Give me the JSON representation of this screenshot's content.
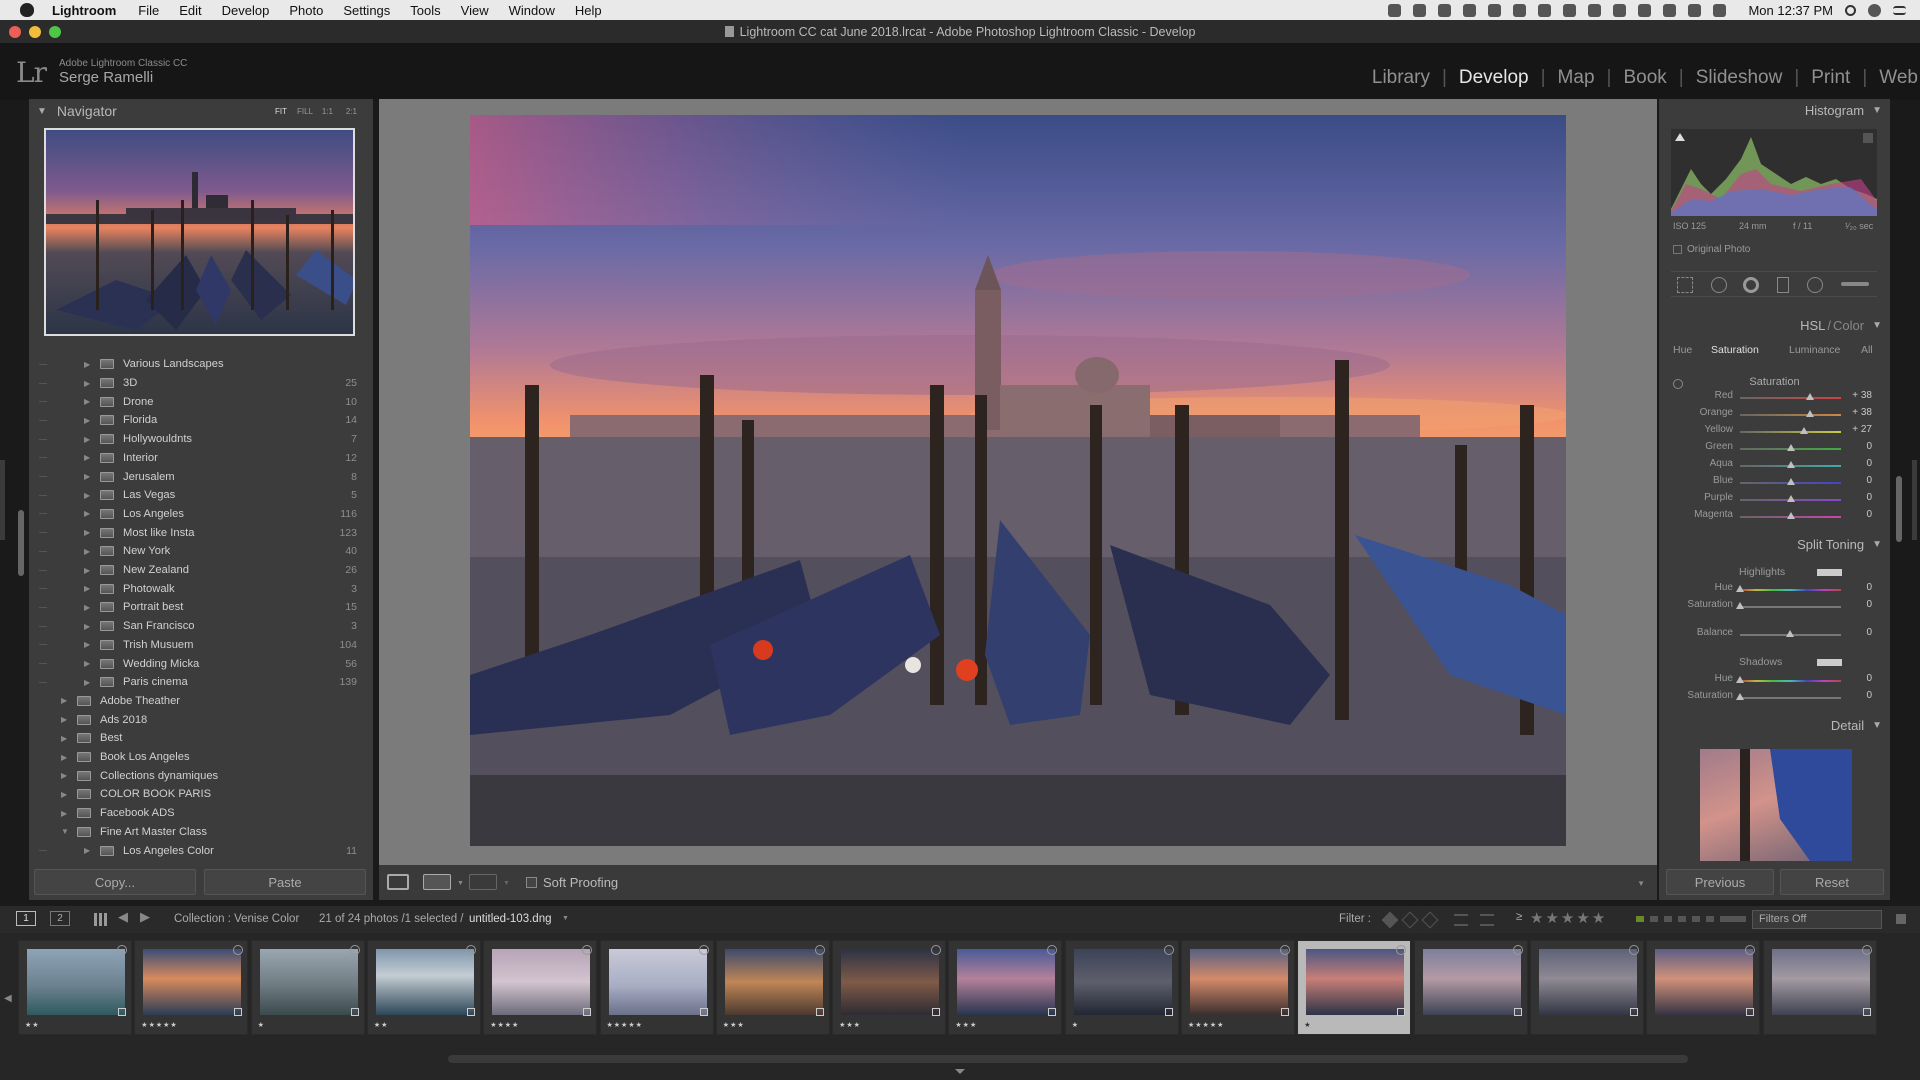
{
  "menubar": {
    "app": "Lightroom",
    "items": [
      "File",
      "Edit",
      "Develop",
      "Photo",
      "Settings",
      "Tools",
      "View",
      "Window",
      "Help"
    ],
    "clock": "Mon 12:37 PM"
  },
  "window": {
    "title": "Lightroom CC cat June 2018.lrcat - Adobe Photoshop Lightroom Classic - Develop"
  },
  "identity": {
    "logo": "Lr",
    "product": "Adobe Lightroom Classic CC",
    "user": "Serge Ramelli"
  },
  "modules": [
    {
      "label": "Library",
      "active": false
    },
    {
      "label": "Develop",
      "active": true
    },
    {
      "label": "Map",
      "active": false
    },
    {
      "label": "Book",
      "active": false
    },
    {
      "label": "Slideshow",
      "active": false
    },
    {
      "label": "Print",
      "active": false
    },
    {
      "label": "Web",
      "active": false
    }
  ],
  "navigator": {
    "title": "Navigator",
    "zoom_fit": "FIT",
    "zoom_fill": "FILL",
    "zoom_1": "1:1",
    "zoom_2": "2:1"
  },
  "collections": [
    {
      "name": "Various Landscapes",
      "count": "",
      "indent": 1,
      "expanded": false
    },
    {
      "name": "3D",
      "count": "25",
      "indent": 1,
      "expanded": false
    },
    {
      "name": "Drone",
      "count": "10",
      "indent": 1,
      "expanded": false
    },
    {
      "name": "Florida",
      "count": "14",
      "indent": 1,
      "expanded": false
    },
    {
      "name": "Hollywouldnts",
      "count": "7",
      "indent": 1,
      "expanded": false
    },
    {
      "name": "Interior",
      "count": "12",
      "indent": 1,
      "expanded": false
    },
    {
      "name": "Jerusalem",
      "count": "8",
      "indent": 1,
      "expanded": false
    },
    {
      "name": "Las Vegas",
      "count": "5",
      "indent": 1,
      "expanded": false
    },
    {
      "name": "Los Angeles",
      "count": "116",
      "indent": 1,
      "expanded": false
    },
    {
      "name": "Most like Insta",
      "count": "123",
      "indent": 1,
      "expanded": false
    },
    {
      "name": "New York",
      "count": "40",
      "indent": 1,
      "expanded": false
    },
    {
      "name": "New Zealand",
      "count": "26",
      "indent": 1,
      "expanded": false
    },
    {
      "name": "Photowalk",
      "count": "3",
      "indent": 1,
      "expanded": false
    },
    {
      "name": "Portrait best",
      "count": "15",
      "indent": 1,
      "expanded": false
    },
    {
      "name": "San Francisco",
      "count": "3",
      "indent": 1,
      "expanded": false
    },
    {
      "name": "Trish Musuem",
      "count": "104",
      "indent": 1,
      "expanded": false
    },
    {
      "name": "Wedding Micka",
      "count": "56",
      "indent": 1,
      "expanded": false
    },
    {
      "name": "Paris cinema",
      "count": "139",
      "indent": 1,
      "expanded": false
    },
    {
      "name": "Adobe Theather",
      "count": "",
      "indent": 0,
      "expanded": false
    },
    {
      "name": "Ads 2018",
      "count": "",
      "indent": 0,
      "expanded": false
    },
    {
      "name": "Best",
      "count": "",
      "indent": 0,
      "expanded": false
    },
    {
      "name": "Book Los Angeles",
      "count": "",
      "indent": 0,
      "expanded": false
    },
    {
      "name": "Collections dynamiques",
      "count": "",
      "indent": 0,
      "expanded": false
    },
    {
      "name": "COLOR BOOK PARIS",
      "count": "",
      "indent": 0,
      "expanded": false
    },
    {
      "name": "Facebook ADS",
      "count": "",
      "indent": 0,
      "expanded": false
    },
    {
      "name": "Fine Art Master Class",
      "count": "",
      "indent": 0,
      "expanded": true
    },
    {
      "name": "Los Angeles Color",
      "count": "11",
      "indent": 1,
      "expanded": false
    }
  ],
  "left_buttons": {
    "copy": "Copy...",
    "paste": "Paste"
  },
  "toolbar": {
    "soft_proofing": "Soft Proofing"
  },
  "histogram": {
    "title": "Histogram",
    "iso": "ISO 125",
    "focal": "24 mm",
    "aperture": "f / 11",
    "shutter": "¹⁄₂₀ sec",
    "original": "Original Photo"
  },
  "hsl": {
    "title_a": "HSL",
    "title_b": "Color",
    "tabs": [
      "Hue",
      "Saturation",
      "Luminance",
      "All"
    ],
    "active_tab": "Saturation",
    "section": "Saturation",
    "rows": [
      {
        "label": "Red",
        "value": "+ 38",
        "level": 0.69,
        "color": "#c44"
      },
      {
        "label": "Orange",
        "value": "+ 38",
        "level": 0.69,
        "color": "#c84"
      },
      {
        "label": "Yellow",
        "value": "+ 27",
        "level": 0.635,
        "color": "#cc4"
      },
      {
        "label": "Green",
        "value": "0",
        "level": 0.5,
        "color": "#4a4"
      },
      {
        "label": "Aqua",
        "value": "0",
        "level": 0.5,
        "color": "#4aa"
      },
      {
        "label": "Blue",
        "value": "0",
        "level": 0.5,
        "color": "#44c"
      },
      {
        "label": "Purple",
        "value": "0",
        "level": 0.5,
        "color": "#84c"
      },
      {
        "label": "Magenta",
        "value": "0",
        "level": 0.5,
        "color": "#c4a"
      }
    ]
  },
  "split_toning": {
    "title": "Split Toning",
    "highlights": "Highlights",
    "shadows": "Shadows",
    "hue": "Hue",
    "saturation": "Saturation",
    "balance": "Balance",
    "h_hue": "0",
    "h_sat": "0",
    "bal": "0",
    "s_hue": "0",
    "s_sat": "0"
  },
  "detail": {
    "title": "Detail"
  },
  "right_buttons": {
    "previous": "Previous",
    "reset": "Reset"
  },
  "filmstrip_bar": {
    "page1": "1",
    "page2": "2",
    "collection": "Collection : Venise Color",
    "count": "21 of 24 photos /1 selected /",
    "filename": "untitled-103.dng",
    "filter_label": "Filter :",
    "filters_off": "Filters Off",
    "gte": "≥"
  },
  "thumbnails": [
    {
      "stars": "★★",
      "grad": "linear-gradient(180deg,#8ea3b7,#6d8290 55%,#2f5a5f)"
    },
    {
      "stars": "★★★★★",
      "grad": "linear-gradient(180deg,#3b4d78,#d88a5c 45%,#2b3d56)"
    },
    {
      "stars": "★",
      "grad": "linear-gradient(180deg,#9aa6b1,#6e7c82 55%,#3b4a4d)"
    },
    {
      "stars": "★★",
      "grad": "linear-gradient(180deg,#7f96ad,#c4cdd3 40%,#2d4658)"
    },
    {
      "stars": "★★★★",
      "grad": "linear-gradient(180deg,#b7a4b8,#d3c4cf 50%,#6c6b7a)"
    },
    {
      "stars": "★★★★★",
      "grad": "linear-gradient(180deg,#c9cad8,#a9aec4 55%,#6a7189)"
    },
    {
      "stars": "★★★",
      "grad": "linear-gradient(180deg,#3d4a6e,#c08656 50%,#4b3a30)"
    },
    {
      "stars": "★★★",
      "grad": "linear-gradient(180deg,#2c3346,#7f5a48 50%,#2e2c33)"
    },
    {
      "stars": "★★★",
      "grad": "linear-gradient(180deg,#4a5a98,#b4819a 45%,#28344e)"
    },
    {
      "stars": "★",
      "grad": "linear-gradient(180deg,#3b4358,#5f5f6c 50%,#222733)"
    },
    {
      "stars": "★★★★★",
      "grad": "linear-gradient(180deg,#566083,#d48a6a 45%,#3a2e2e)"
    },
    {
      "stars": "★",
      "grad": "linear-gradient(180deg,#4a5682,#c87f78 45%,#2c3447)"
    },
    {
      "stars": "",
      "grad": "linear-gradient(180deg,#7d7f9c,#b49aa4 45%,#3d4355)"
    },
    {
      "stars": "",
      "grad": "linear-gradient(180deg,#5e6278,#8f8a94 45%,#323644)"
    },
    {
      "stars": "",
      "grad": "linear-gradient(180deg,#5d5e85,#d1917a 45%,#363444)"
    },
    {
      "stars": "",
      "grad": "linear-gradient(180deg,#6d7088,#a39aa2 45%,#3f4250)"
    }
  ]
}
